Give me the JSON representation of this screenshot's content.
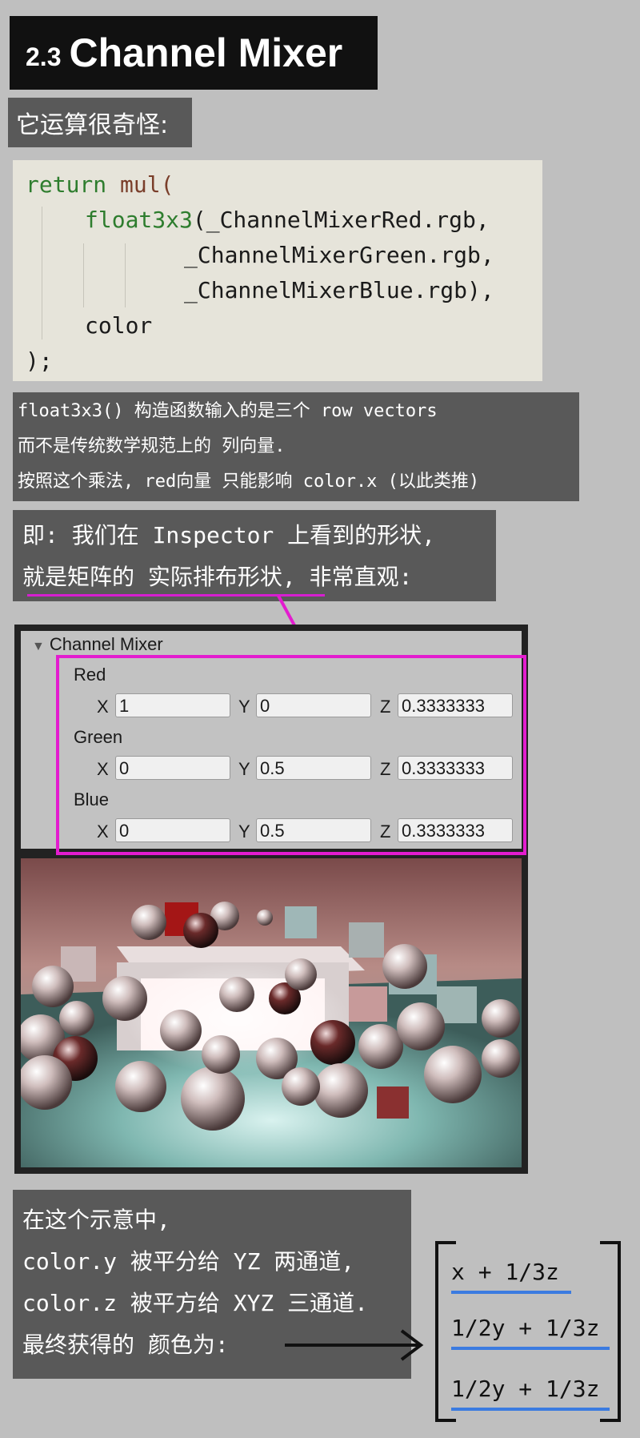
{
  "title": {
    "number": "2.3",
    "text": "Channel Mixer"
  },
  "subtitle": "它运算很奇怪:",
  "code": {
    "lines": [
      {
        "a": "return",
        "b": " ",
        "c": "mul",
        "d": "("
      },
      {
        "a": "float3x3",
        "b": "(_ChannelMixerRed.rgb,"
      },
      {
        "a": "_ChannelMixerGreen.rgb,"
      },
      {
        "a": "_ChannelMixerBlue.rgb),"
      },
      {
        "a": "color"
      },
      {
        "a": ");"
      }
    ]
  },
  "note": {
    "lines": [
      "float3x3() 构造函数输入的是三个 row vectors",
      "而不是传统数学规范上的 列向量.",
      "按照这个乘法, red向量 只能影响 color.x (以此类推)"
    ]
  },
  "callout": {
    "line1": "即: 我们在 Inspector 上看到的形状,",
    "line2a": "就是矩阵的 实际排布形状",
    "line2b": ", 非常直观:"
  },
  "inspector": {
    "header": "Channel Mixer",
    "rows": [
      {
        "label": "Red",
        "x": "1",
        "y": "0",
        "z": "0.3333333"
      },
      {
        "label": "Green",
        "x": "0",
        "y": "0.5",
        "z": "0.3333333"
      },
      {
        "label": "Blue",
        "x": "0",
        "y": "0.5",
        "z": "0.3333333"
      }
    ],
    "axis_x": "X",
    "axis_y": "Y",
    "axis_z": "Z"
  },
  "explain": {
    "lines": [
      "在这个示意中,",
      "color.y 被平分给 YZ 两通道,",
      "color.z 被平方给 XYZ 三通道.",
      "最终获得的 颜色为:"
    ]
  },
  "matrix": {
    "items": [
      "x + 1/3z",
      "1/2y + 1/3z",
      "1/2y + 1/3z"
    ]
  },
  "colors": {
    "highlight": "#e31ccf",
    "underline_blue": "#3b7be0",
    "keyword": "#2e7d2e"
  }
}
